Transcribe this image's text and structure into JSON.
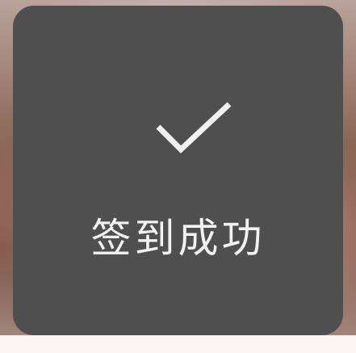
{
  "toast": {
    "icon": "checkmark-icon",
    "message": "签到成功"
  },
  "colors": {
    "toast_background": "#4f4f4f",
    "text": "#f2f2f2",
    "icon": "#f2f2f2"
  }
}
